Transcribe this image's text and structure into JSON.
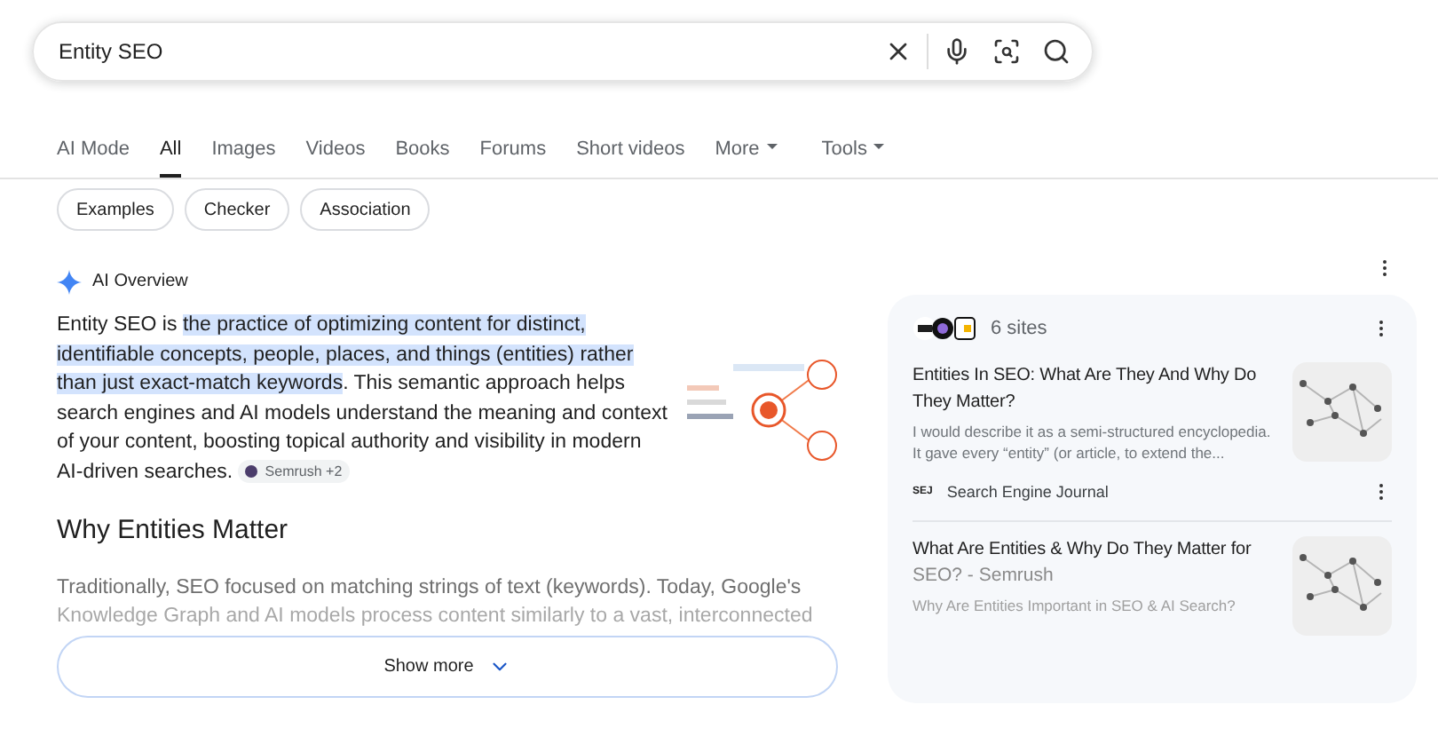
{
  "search": {
    "value": "Entity SEO"
  },
  "tabs": [
    {
      "label": "AI Mode",
      "selected": false,
      "kind": "plain"
    },
    {
      "label": "All",
      "selected": true,
      "kind": "plain"
    },
    {
      "label": "Images",
      "selected": false,
      "kind": "plain"
    },
    {
      "label": "Videos",
      "selected": false,
      "kind": "plain"
    },
    {
      "label": "Books",
      "selected": false,
      "kind": "plain"
    },
    {
      "label": "Forums",
      "selected": false,
      "kind": "plain"
    },
    {
      "label": "Short videos",
      "selected": false,
      "kind": "plain"
    },
    {
      "label": "More",
      "selected": false,
      "kind": "menu"
    },
    {
      "label": "Tools",
      "selected": false,
      "kind": "menu"
    }
  ],
  "chips": [
    "Examples",
    "Checker",
    "Association"
  ],
  "ai_overview": {
    "title": "AI Overview",
    "intro": "Entity SEO is ",
    "highlight": "the practice of optimizing content for distinct, identifiable concepts, people, places, and things (entities) rather than just exact-match keywords",
    "rest": ". This semantic approach helps search engines and AI models understand the meaning and context of your content, boosting topical authority and visibility in modern AI-driven searches.",
    "source_chip": "Semrush +2",
    "heading": "Why Entities Matter",
    "paragraph": "Traditionally, SEO focused on matching strings of text (keywords). Today, Google's",
    "faded_line": "Knowledge Graph and AI models process content similarly to a vast, interconnected",
    "show_more": "Show more"
  },
  "sources": {
    "count": "6 sites",
    "items": [
      {
        "title": "Entities In SEO: What Are They And Why Do They Matter?",
        "snippet": "I would describe it as a semi-structured encyclopedia. It gave every “entity” (or article, to extend the...",
        "site": "Search Engine Journal",
        "site_logo": "SEJ"
      },
      {
        "title": "What Are Entities & Why Do They Matter for",
        "title_faded": "SEO? - Semrush",
        "snippet": "Why Are Entities Important in SEO & AI Search?"
      }
    ]
  }
}
